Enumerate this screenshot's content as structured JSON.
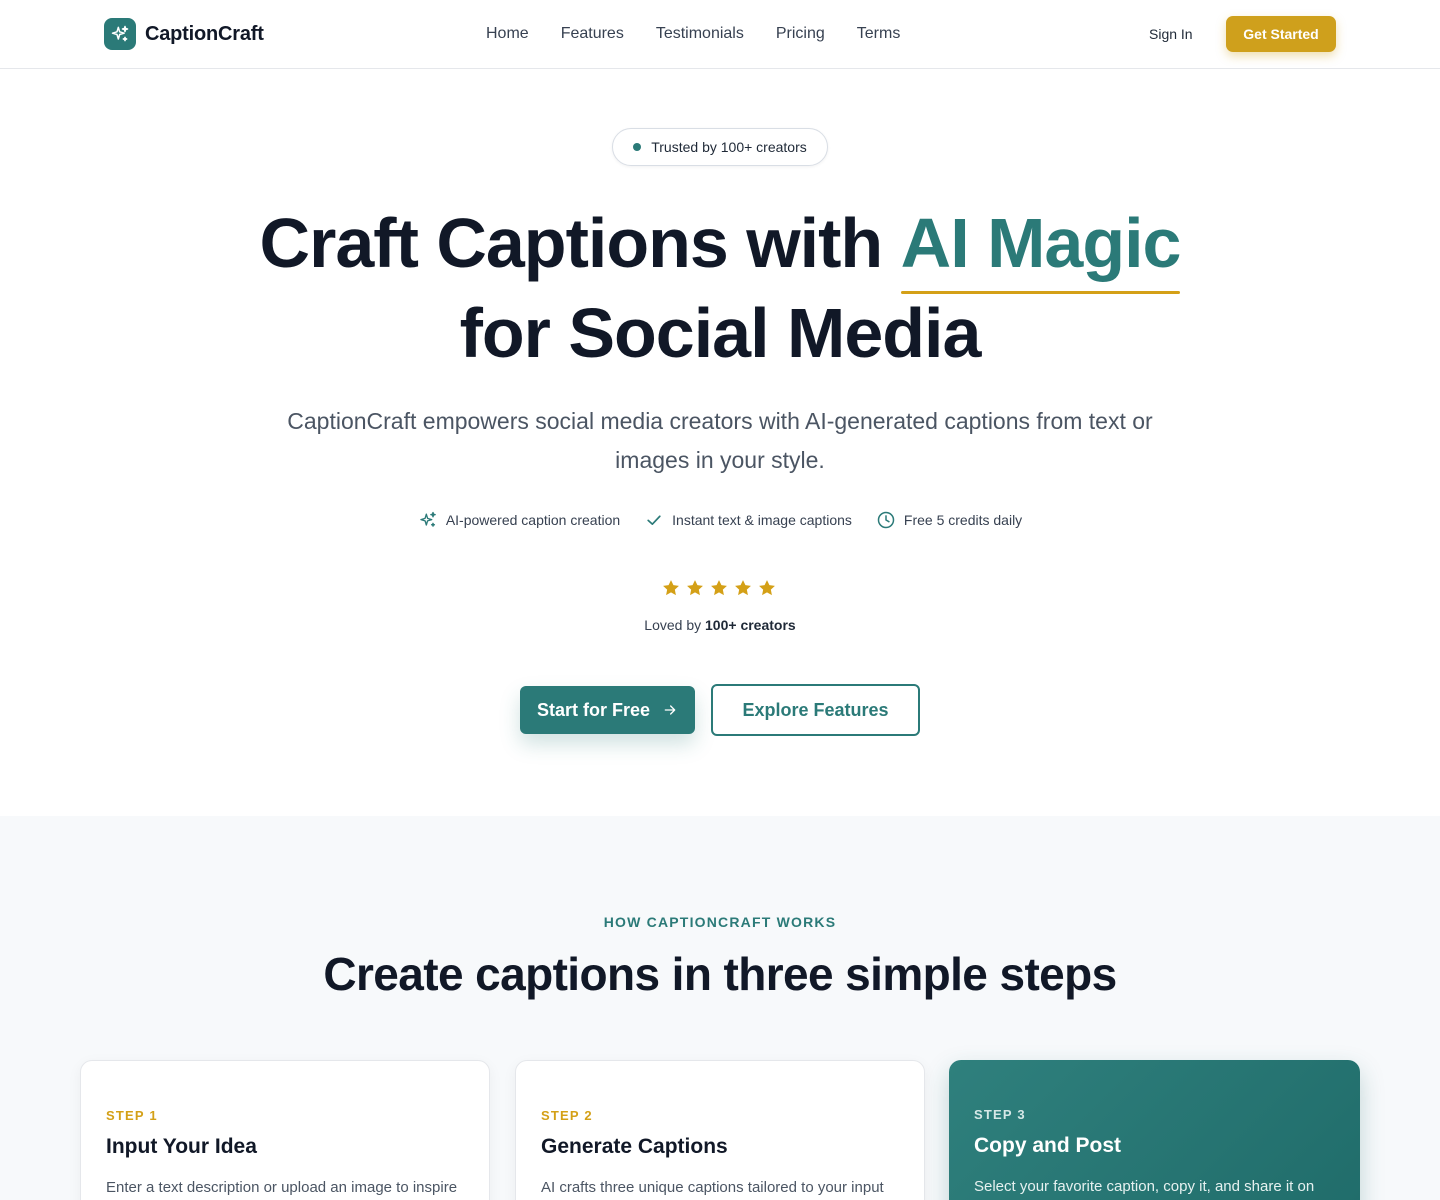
{
  "brand": {
    "name": "CaptionCraft",
    "logo_icon": "sparkles-icon",
    "accent": "#2b7a78",
    "gold": "#d4a017"
  },
  "nav": {
    "links": [
      "Home",
      "Features",
      "Testimonials",
      "Pricing",
      "Terms"
    ],
    "sign_in": "Sign In",
    "get_started": "Get Started"
  },
  "hero": {
    "badge": "Trusted by 100+ creators",
    "title_part1": "Craft Captions with ",
    "title_accent": "AI Magic",
    "title_part2": "for Social Media",
    "subtitle": "CaptionCraft empowers social media creators with AI-generated captions from text or images in your style.",
    "features": [
      {
        "icon": "sparkles-icon",
        "label": "AI-powered caption creation"
      },
      {
        "icon": "check-icon",
        "label": "Instant text & image captions"
      },
      {
        "icon": "clock-icon",
        "label": "Free 5 credits daily"
      }
    ],
    "rating": {
      "stars": 5,
      "max": 5
    },
    "loved_prefix": "Loved by ",
    "loved_strong": "100+ creators",
    "cta_primary": "Start for Free",
    "cta_secondary": "Explore Features"
  },
  "how": {
    "eyebrow": "HOW CAPTIONCRAFT WORKS",
    "title": "Create captions in three simple steps",
    "steps": [
      {
        "step": "STEP 1",
        "title": "Input Your Idea",
        "desc": "Enter a text description or upload an image to inspire"
      },
      {
        "step": "STEP 2",
        "title": "Generate Captions",
        "desc": "AI crafts three unique captions tailored to your input in"
      },
      {
        "step": "STEP 3",
        "title": "Copy and Post",
        "desc": "Select your favorite caption, copy it, and share it on"
      }
    ]
  }
}
